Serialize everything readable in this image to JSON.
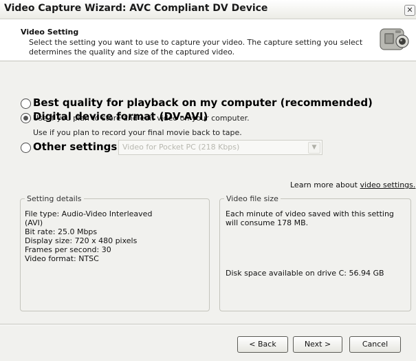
{
  "window": {
    "title": "Video Capture Wizard: AVC Compliant DV Device",
    "close_glyph": "✕"
  },
  "header": {
    "title": "Video Setting",
    "description_line1": "Select the setting you want to use to capture your video. The capture setting you select",
    "description_line2": "determines the quality and size of the captured video.",
    "icon": "camcorder-icon"
  },
  "options": [
    {
      "label": "Best quality for playback on my computer (recommended)",
      "description": "Use if you plan to store and edit video on your computer.",
      "selected": false
    },
    {
      "label": "Digital device format (DV-AVI)",
      "description": "Use if you plan to record your final movie back to tape.",
      "selected": true
    },
    {
      "label": "Other settings",
      "selected": false
    }
  ],
  "other_settings_select": {
    "value": "Video for Pocket PC (218 Kbps)",
    "enabled": false
  },
  "learn_more": {
    "prefix": "Learn more about ",
    "link_text": "video settings."
  },
  "setting_details": {
    "legend": "Setting details",
    "lines": [
      "File type: Audio-Video Interleaved",
      "(AVI)",
      "Bit rate: 25.0 Mbps",
      "Display size: 720 x 480 pixels",
      "Frames per second: 30",
      "Video format: NTSC"
    ]
  },
  "video_file_size": {
    "legend": "Video file size",
    "line1": "Each minute of video saved with this setting",
    "line2": "will consume 178 MB.",
    "disk_space": "Disk space available on drive C: 56.94 GB"
  },
  "buttons": {
    "back": "< Back",
    "next": "Next >",
    "cancel": "Cancel"
  },
  "colors": {
    "window_bg": "#f1f1ee",
    "header_bg": "#ffffff",
    "border": "#c4c4bc"
  }
}
